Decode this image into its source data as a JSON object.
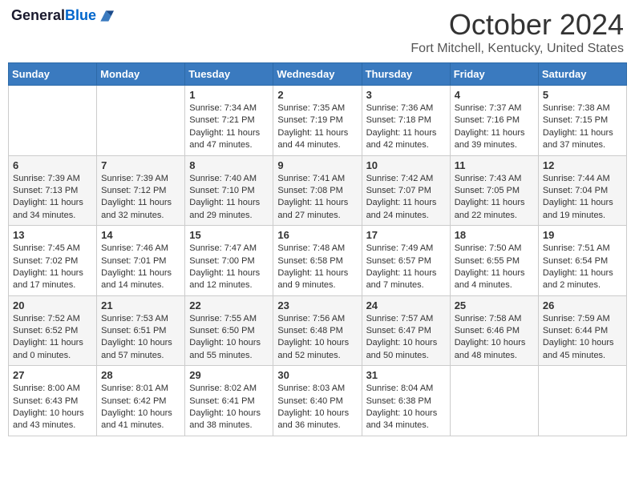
{
  "header": {
    "logo_line1": "General",
    "logo_line2": "Blue",
    "month_title": "October 2024",
    "location": "Fort Mitchell, Kentucky, United States"
  },
  "weekdays": [
    "Sunday",
    "Monday",
    "Tuesday",
    "Wednesday",
    "Thursday",
    "Friday",
    "Saturday"
  ],
  "weeks": [
    [
      {
        "day": "",
        "sunrise": "",
        "sunset": "",
        "daylight": ""
      },
      {
        "day": "",
        "sunrise": "",
        "sunset": "",
        "daylight": ""
      },
      {
        "day": "1",
        "sunrise": "Sunrise: 7:34 AM",
        "sunset": "Sunset: 7:21 PM",
        "daylight": "Daylight: 11 hours and 47 minutes."
      },
      {
        "day": "2",
        "sunrise": "Sunrise: 7:35 AM",
        "sunset": "Sunset: 7:19 PM",
        "daylight": "Daylight: 11 hours and 44 minutes."
      },
      {
        "day": "3",
        "sunrise": "Sunrise: 7:36 AM",
        "sunset": "Sunset: 7:18 PM",
        "daylight": "Daylight: 11 hours and 42 minutes."
      },
      {
        "day": "4",
        "sunrise": "Sunrise: 7:37 AM",
        "sunset": "Sunset: 7:16 PM",
        "daylight": "Daylight: 11 hours and 39 minutes."
      },
      {
        "day": "5",
        "sunrise": "Sunrise: 7:38 AM",
        "sunset": "Sunset: 7:15 PM",
        "daylight": "Daylight: 11 hours and 37 minutes."
      }
    ],
    [
      {
        "day": "6",
        "sunrise": "Sunrise: 7:39 AM",
        "sunset": "Sunset: 7:13 PM",
        "daylight": "Daylight: 11 hours and 34 minutes."
      },
      {
        "day": "7",
        "sunrise": "Sunrise: 7:39 AM",
        "sunset": "Sunset: 7:12 PM",
        "daylight": "Daylight: 11 hours and 32 minutes."
      },
      {
        "day": "8",
        "sunrise": "Sunrise: 7:40 AM",
        "sunset": "Sunset: 7:10 PM",
        "daylight": "Daylight: 11 hours and 29 minutes."
      },
      {
        "day": "9",
        "sunrise": "Sunrise: 7:41 AM",
        "sunset": "Sunset: 7:08 PM",
        "daylight": "Daylight: 11 hours and 27 minutes."
      },
      {
        "day": "10",
        "sunrise": "Sunrise: 7:42 AM",
        "sunset": "Sunset: 7:07 PM",
        "daylight": "Daylight: 11 hours and 24 minutes."
      },
      {
        "day": "11",
        "sunrise": "Sunrise: 7:43 AM",
        "sunset": "Sunset: 7:05 PM",
        "daylight": "Daylight: 11 hours and 22 minutes."
      },
      {
        "day": "12",
        "sunrise": "Sunrise: 7:44 AM",
        "sunset": "Sunset: 7:04 PM",
        "daylight": "Daylight: 11 hours and 19 minutes."
      }
    ],
    [
      {
        "day": "13",
        "sunrise": "Sunrise: 7:45 AM",
        "sunset": "Sunset: 7:02 PM",
        "daylight": "Daylight: 11 hours and 17 minutes."
      },
      {
        "day": "14",
        "sunrise": "Sunrise: 7:46 AM",
        "sunset": "Sunset: 7:01 PM",
        "daylight": "Daylight: 11 hours and 14 minutes."
      },
      {
        "day": "15",
        "sunrise": "Sunrise: 7:47 AM",
        "sunset": "Sunset: 7:00 PM",
        "daylight": "Daylight: 11 hours and 12 minutes."
      },
      {
        "day": "16",
        "sunrise": "Sunrise: 7:48 AM",
        "sunset": "Sunset: 6:58 PM",
        "daylight": "Daylight: 11 hours and 9 minutes."
      },
      {
        "day": "17",
        "sunrise": "Sunrise: 7:49 AM",
        "sunset": "Sunset: 6:57 PM",
        "daylight": "Daylight: 11 hours and 7 minutes."
      },
      {
        "day": "18",
        "sunrise": "Sunrise: 7:50 AM",
        "sunset": "Sunset: 6:55 PM",
        "daylight": "Daylight: 11 hours and 4 minutes."
      },
      {
        "day": "19",
        "sunrise": "Sunrise: 7:51 AM",
        "sunset": "Sunset: 6:54 PM",
        "daylight": "Daylight: 11 hours and 2 minutes."
      }
    ],
    [
      {
        "day": "20",
        "sunrise": "Sunrise: 7:52 AM",
        "sunset": "Sunset: 6:52 PM",
        "daylight": "Daylight: 11 hours and 0 minutes."
      },
      {
        "day": "21",
        "sunrise": "Sunrise: 7:53 AM",
        "sunset": "Sunset: 6:51 PM",
        "daylight": "Daylight: 10 hours and 57 minutes."
      },
      {
        "day": "22",
        "sunrise": "Sunrise: 7:55 AM",
        "sunset": "Sunset: 6:50 PM",
        "daylight": "Daylight: 10 hours and 55 minutes."
      },
      {
        "day": "23",
        "sunrise": "Sunrise: 7:56 AM",
        "sunset": "Sunset: 6:48 PM",
        "daylight": "Daylight: 10 hours and 52 minutes."
      },
      {
        "day": "24",
        "sunrise": "Sunrise: 7:57 AM",
        "sunset": "Sunset: 6:47 PM",
        "daylight": "Daylight: 10 hours and 50 minutes."
      },
      {
        "day": "25",
        "sunrise": "Sunrise: 7:58 AM",
        "sunset": "Sunset: 6:46 PM",
        "daylight": "Daylight: 10 hours and 48 minutes."
      },
      {
        "day": "26",
        "sunrise": "Sunrise: 7:59 AM",
        "sunset": "Sunset: 6:44 PM",
        "daylight": "Daylight: 10 hours and 45 minutes."
      }
    ],
    [
      {
        "day": "27",
        "sunrise": "Sunrise: 8:00 AM",
        "sunset": "Sunset: 6:43 PM",
        "daylight": "Daylight: 10 hours and 43 minutes."
      },
      {
        "day": "28",
        "sunrise": "Sunrise: 8:01 AM",
        "sunset": "Sunset: 6:42 PM",
        "daylight": "Daylight: 10 hours and 41 minutes."
      },
      {
        "day": "29",
        "sunrise": "Sunrise: 8:02 AM",
        "sunset": "Sunset: 6:41 PM",
        "daylight": "Daylight: 10 hours and 38 minutes."
      },
      {
        "day": "30",
        "sunrise": "Sunrise: 8:03 AM",
        "sunset": "Sunset: 6:40 PM",
        "daylight": "Daylight: 10 hours and 36 minutes."
      },
      {
        "day": "31",
        "sunrise": "Sunrise: 8:04 AM",
        "sunset": "Sunset: 6:38 PM",
        "daylight": "Daylight: 10 hours and 34 minutes."
      },
      {
        "day": "",
        "sunrise": "",
        "sunset": "",
        "daylight": ""
      },
      {
        "day": "",
        "sunrise": "",
        "sunset": "",
        "daylight": ""
      }
    ]
  ]
}
